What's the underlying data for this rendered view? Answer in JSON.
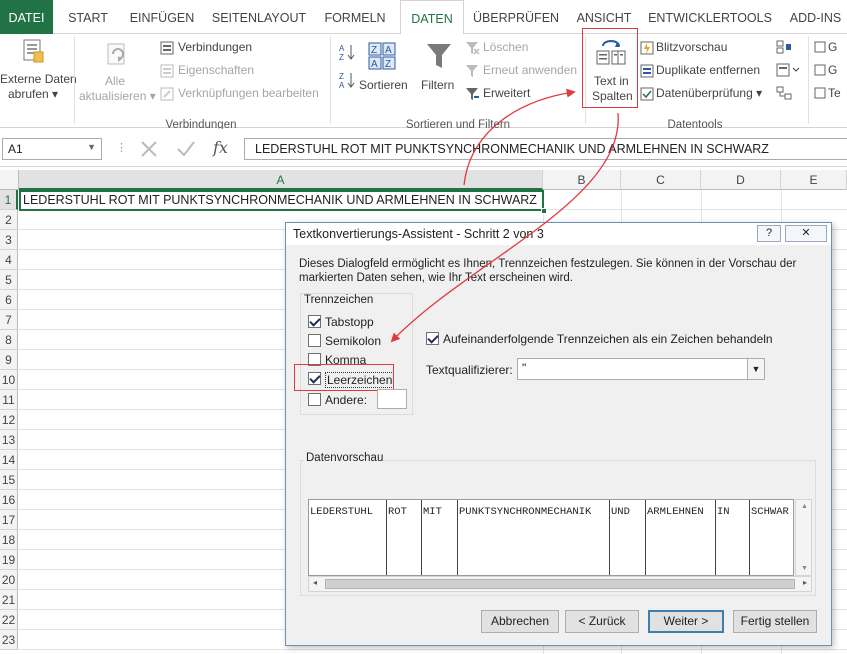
{
  "ribbon_tabs": [
    "DATEI",
    "START",
    "EINFÜGEN",
    "SEITENLAYOUT",
    "FORMELN",
    "DATEN",
    "ÜBERPRÜFEN",
    "ANSICHT",
    "ENTWICKLERTOOLS",
    "ADD-INS"
  ],
  "active_tab": "DATEN",
  "ribbon": {
    "external_data": {
      "line1": "Externe Daten",
      "line2": "abrufen"
    },
    "refresh_all": {
      "line1": "Alle",
      "line2": "aktualisieren"
    },
    "connections": "Verbindungen",
    "properties": "Eigenschaften",
    "edit_links": "Verknüpfungen bearbeiten",
    "group_connections": "Verbindungen",
    "sort": "Sortieren",
    "filter": "Filtern",
    "clear": "Löschen",
    "reapply": "Erneut anwenden",
    "advanced": "Erweitert",
    "group_sort_filter": "Sortieren und Filtern",
    "text_to_columns": {
      "line1": "Text in",
      "line2": "Spalten"
    },
    "flash_fill": "Blitzvorschau",
    "remove_duplicates": "Duplikate entfernen",
    "data_validation": "Datenüberprüfung",
    "group_data_tools": "Datentools",
    "outline_labels": [
      "G",
      "G",
      "Te"
    ]
  },
  "formula_bar": {
    "name_box": "A1",
    "fx_label": "fx",
    "content": "LEDERSTUHL ROT MIT PUNKTSYNCHRONMECHANIK UND ARMLEHNEN IN SCHWARZ"
  },
  "sheet": {
    "columns": [
      "A",
      "B",
      "C",
      "D",
      "E"
    ],
    "rows": [
      "1",
      "2",
      "3",
      "4",
      "5",
      "6",
      "7",
      "8",
      "9",
      "10",
      "11",
      "12",
      "13",
      "14",
      "15",
      "16",
      "17",
      "18",
      "19",
      "20",
      "21",
      "22",
      "23"
    ],
    "cell_a1": "LEDERSTUHL ROT MIT PUNKTSYNCHRONMECHANIK UND ARMLEHNEN IN SCHWARZ"
  },
  "dialog": {
    "title": "Textkonvertierungs-Assistent - Schritt 2 von 3",
    "help_glyph": "?",
    "close_glyph": "✕",
    "description": "Dieses Dialogfeld ermöglicht es Ihnen, Trennzeichen festzulegen. Sie können in der Vorschau der markierten Daten sehen, wie Ihr Text erscheinen wird.",
    "delimiters_title": "Trennzeichen",
    "delimiters": [
      {
        "label": "Tabstopp",
        "checked": true
      },
      {
        "label": "Semikolon",
        "checked": false
      },
      {
        "label": "Komma",
        "checked": false
      },
      {
        "label": "Leerzeichen",
        "checked": true
      },
      {
        "label": "Andere:",
        "checked": false
      }
    ],
    "consecutive_label": "Aufeinanderfolgende Trennzeichen als ein Zeichen behandeln",
    "consecutive_checked": true,
    "qualifier_label": "Textqualifizierer:",
    "qualifier_value": "\"",
    "preview_title": "Datenvorschau",
    "preview_tokens": [
      "LEDERSTUHL",
      "ROT",
      "MIT",
      "PUNKTSYNCHRONMECHANIK",
      "UND",
      "ARMLEHNEN",
      "IN",
      "SCHWAR"
    ],
    "buttons": {
      "cancel": "Abbrechen",
      "back": "< Zurück",
      "next": "Weiter >",
      "finish": "Fertig stellen"
    }
  },
  "colors": {
    "accent": "#217346",
    "highlight": "#e0393e",
    "dialog_border": "#6f8fb4"
  }
}
